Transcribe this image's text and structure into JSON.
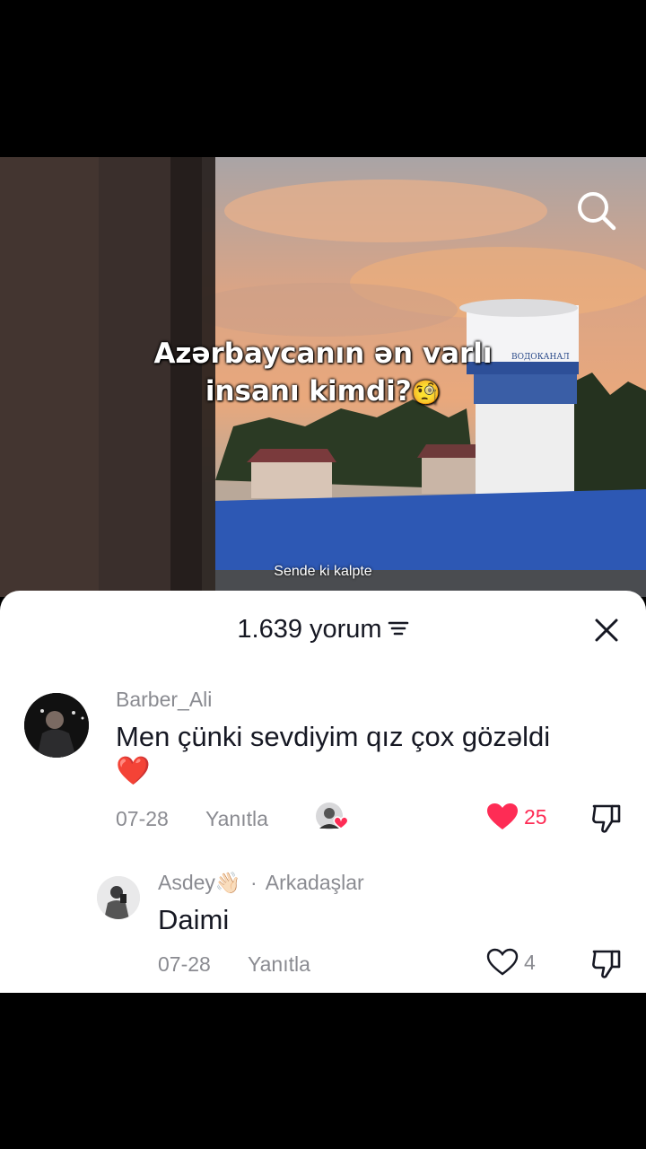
{
  "video": {
    "overlay_line1": "Azərbaycanın ən varlı",
    "overlay_line2": "insanı kimdi?",
    "caption": "Sende ki kalpte",
    "tower_sign": "ВОДОКАНАЛ"
  },
  "comments_sheet": {
    "count_label": "1.639 yorum",
    "comments": [
      {
        "username": "Barber_Ali",
        "text": "Men çünki sevdiyim qız çox gözəldi",
        "emoji": "❤️",
        "date": "07-28",
        "reply_label": "Yanıtla",
        "likes": "25",
        "liked": true,
        "author_liked": true
      }
    ],
    "replies": [
      {
        "username": "Asdey👋🏻",
        "separator": "·",
        "relation": "Arkadaşlar",
        "text": "Daimi",
        "date": "07-28",
        "reply_label": "Yanıtla",
        "likes": "4",
        "liked": false
      }
    ]
  },
  "colors": {
    "like_active": "#fe2c55",
    "text_primary": "#161823",
    "text_secondary": "#8a8b91"
  }
}
